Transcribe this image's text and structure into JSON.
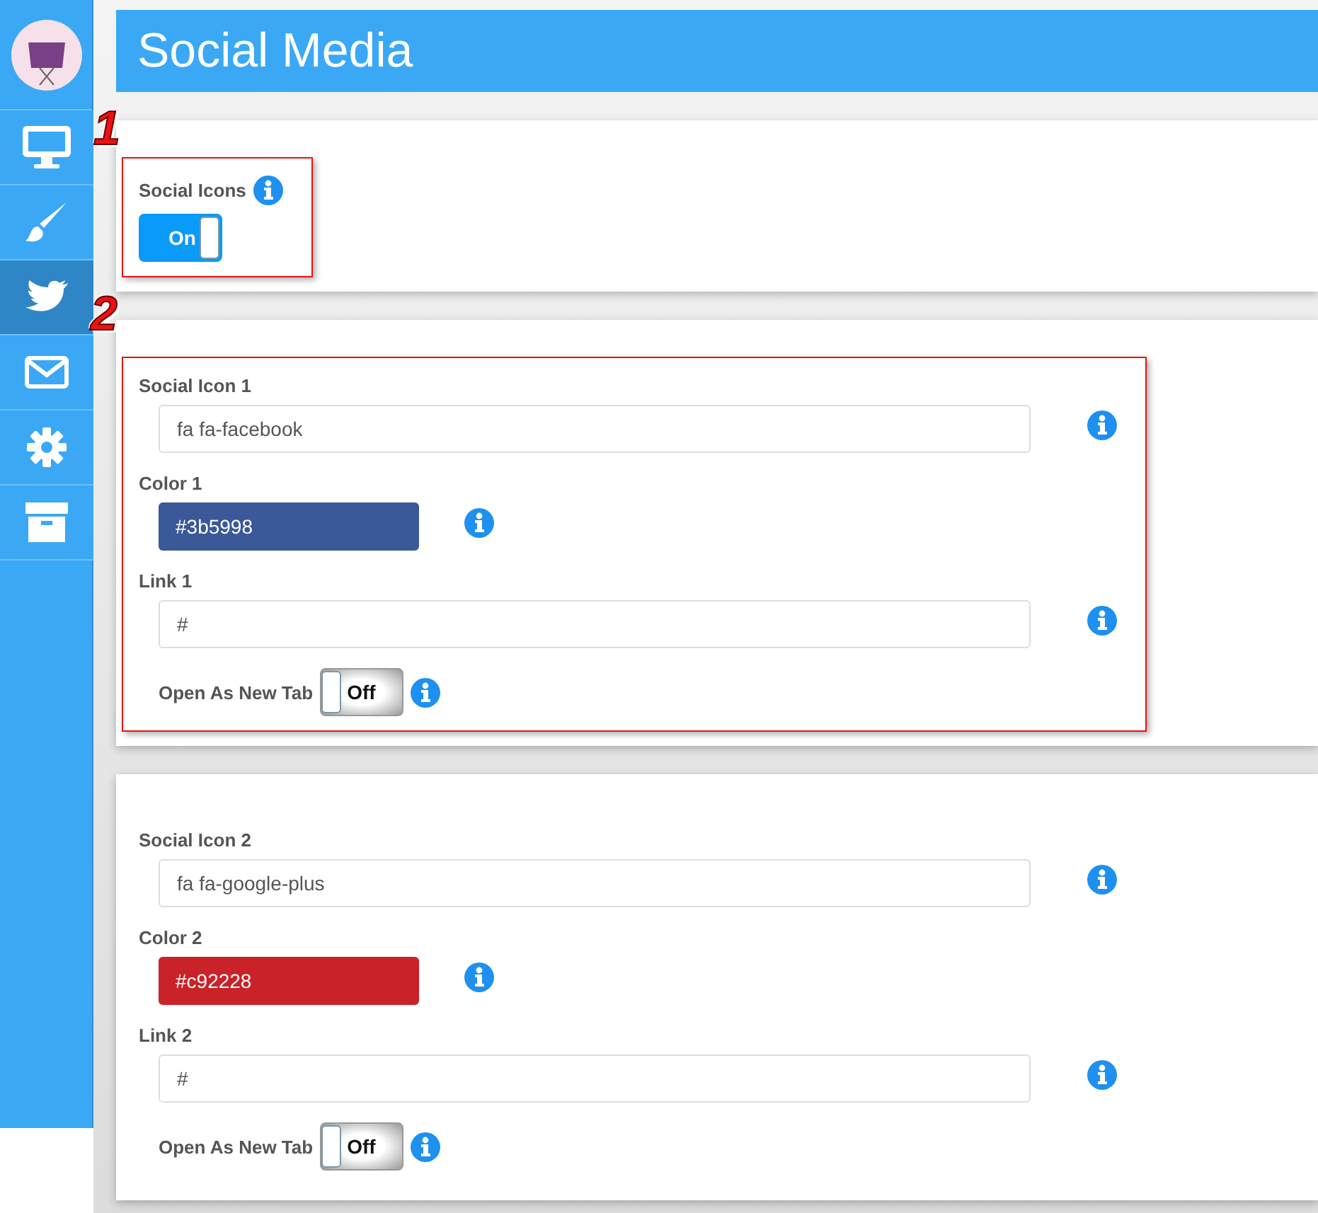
{
  "sidebar": {
    "items": [
      {
        "kind": "monitor",
        "selected": false
      },
      {
        "kind": "brush",
        "selected": false
      },
      {
        "kind": "bird",
        "selected": true
      },
      {
        "kind": "envelope",
        "selected": false
      },
      {
        "kind": "gear",
        "selected": false
      },
      {
        "kind": "archive",
        "selected": false
      }
    ]
  },
  "header": {
    "title": "Social Media"
  },
  "annotations": [
    {
      "text": "1"
    },
    {
      "text": "2"
    }
  ],
  "panels": [
    {
      "highlighted": true,
      "fields": [
        {
          "kind": "switch",
          "label": "Social Icons",
          "on": true,
          "value": "On"
        }
      ]
    },
    {
      "highlighted": true,
      "fields": [
        {
          "kind": "text",
          "label": "Social Icon 1",
          "value": "fa fa-facebook"
        },
        {
          "kind": "color",
          "label": "Color 1",
          "value": "#3b5998",
          "color": "#3b5998"
        },
        {
          "kind": "text",
          "label": "Link 1",
          "value": "#"
        },
        {
          "kind": "tab-switch",
          "label": "Open As New Tab",
          "on": false,
          "value": "Off"
        }
      ]
    },
    {
      "highlighted": false,
      "fields": [
        {
          "kind": "text",
          "label": "Social Icon 2",
          "value": "fa fa-google-plus"
        },
        {
          "kind": "color",
          "label": "Color 2",
          "value": "#c92228",
          "color": "#c92228"
        },
        {
          "kind": "text",
          "label": "Link 2",
          "value": "#"
        },
        {
          "kind": "tab-switch",
          "label": "Open As New Tab",
          "on": false,
          "value": "Off"
        }
      ]
    }
  ]
}
